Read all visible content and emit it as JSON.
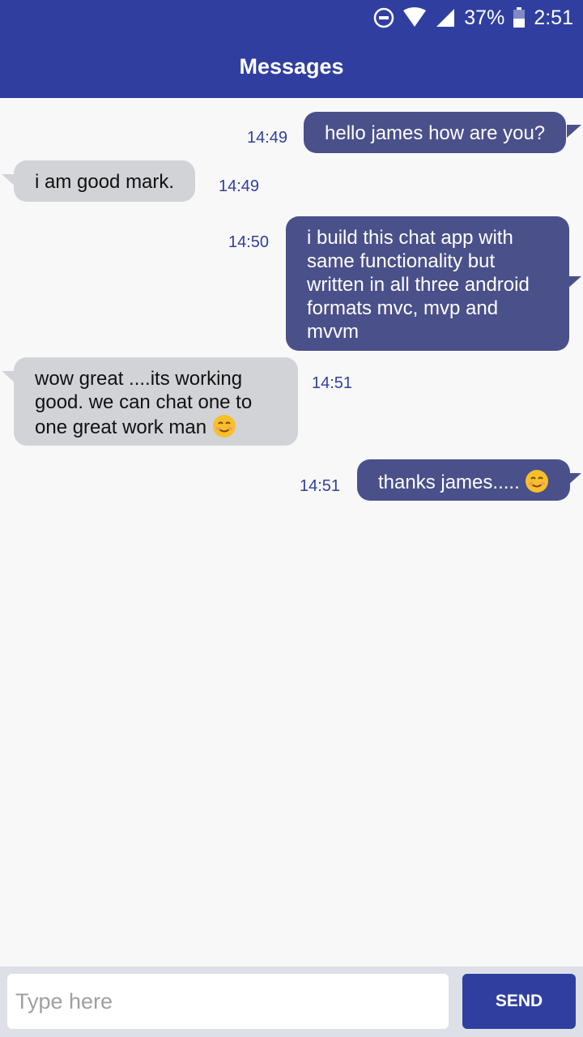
{
  "status_bar": {
    "battery": "37%",
    "time": "2:51"
  },
  "app_bar": {
    "title": "Messages"
  },
  "messages": [
    {
      "direction": "outgoing",
      "text": "hello james how are you?",
      "time": "14:49"
    },
    {
      "direction": "incoming",
      "text": "i am good mark.",
      "time": "14:49"
    },
    {
      "direction": "outgoing",
      "text": "i build this chat app with same functionality but written in all three android formats mvc, mvp and mvvm",
      "time": "14:50"
    },
    {
      "direction": "incoming",
      "text": "wow great ....its working good. we can chat one to one great work man",
      "emoji": "smiling-face-emoji",
      "time": "14:51"
    },
    {
      "direction": "outgoing",
      "text": "thanks james.....",
      "emoji": "smiling-face-emoji",
      "time": "14:51"
    }
  ],
  "composer": {
    "placeholder": "Type here",
    "value": "",
    "send_label": "SEND"
  },
  "colors": {
    "primary": "#303f9f",
    "outgoing_bubble": "#4a508a",
    "incoming_bubble": "#d2d3d7",
    "background": "#f8f8f8"
  }
}
